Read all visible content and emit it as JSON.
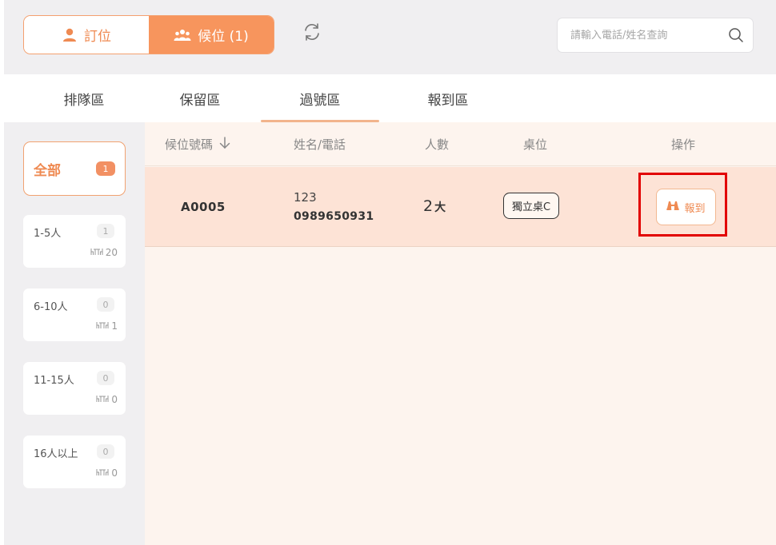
{
  "header": {
    "reserve_label": "訂位",
    "waitlist_label": "候位 (1)",
    "search_placeholder": "請輸入電話/姓名查詢"
  },
  "tabs": [
    {
      "label": "排隊區"
    },
    {
      "label": "保留區"
    },
    {
      "label": "過號區",
      "active": true
    },
    {
      "label": "報到區"
    }
  ],
  "sidebar": {
    "all": {
      "label": "全部",
      "count": "1"
    },
    "groups": [
      {
        "label": "1-5人",
        "count": "1",
        "tables": "20"
      },
      {
        "label": "6-10人",
        "count": "0",
        "tables": "1"
      },
      {
        "label": "11-15人",
        "count": "0",
        "tables": "0"
      },
      {
        "label": "16人以上",
        "count": "0",
        "tables": "0"
      }
    ]
  },
  "table": {
    "columns": {
      "code": "候位號碼",
      "name_phone": "姓名/電話",
      "people": "人數",
      "table": "桌位",
      "action": "操作"
    },
    "rows": [
      {
        "code": "A0005",
        "name": "123",
        "phone": "0989650931",
        "people_count": "2",
        "people_unit": "大",
        "table": "獨立桌C",
        "action_label": "報到"
      }
    ]
  },
  "colors": {
    "accent": "#f7955d",
    "highlight_row": "#fde3d6",
    "content_bg": "#fdf4ee",
    "annotation_box": "#e20000"
  }
}
